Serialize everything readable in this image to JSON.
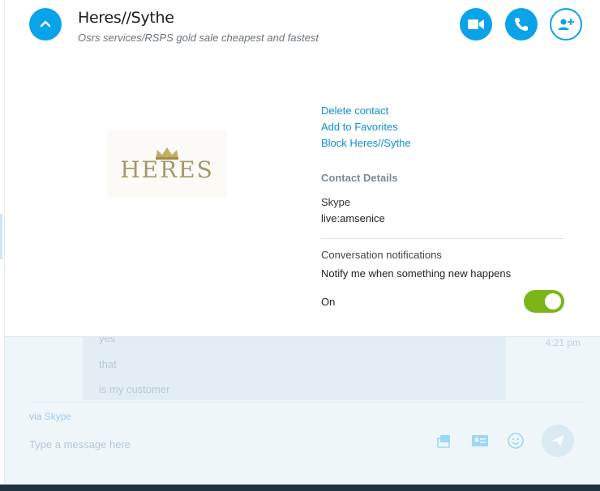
{
  "header": {
    "title": "Heres//Sythe",
    "subtitle": "Osrs services/RSPS gold sale cheapest and fastest"
  },
  "avatar": {
    "logo_text": "HERES"
  },
  "actions": {
    "delete_contact": "Delete contact",
    "add_favorites": "Add to Favorites",
    "block": "Block Heres//Sythe"
  },
  "details": {
    "heading": "Contact Details",
    "skype_label": "Skype",
    "skype_value": "live:amsenice"
  },
  "notifications": {
    "heading": "Conversation notifications",
    "description": "Notify me when something new happens",
    "toggle_label": "On",
    "enabled": true
  },
  "chat": {
    "messages": [
      "yes",
      "that",
      "is my customer"
    ],
    "time": "4:21 pm",
    "via_prefix": "via",
    "via_link": "Skype",
    "compose_placeholder": "Type a message here"
  },
  "colors": {
    "accent": "#0aa2e8",
    "toggle_on": "#7cb518",
    "link": "#0e8dd4"
  }
}
